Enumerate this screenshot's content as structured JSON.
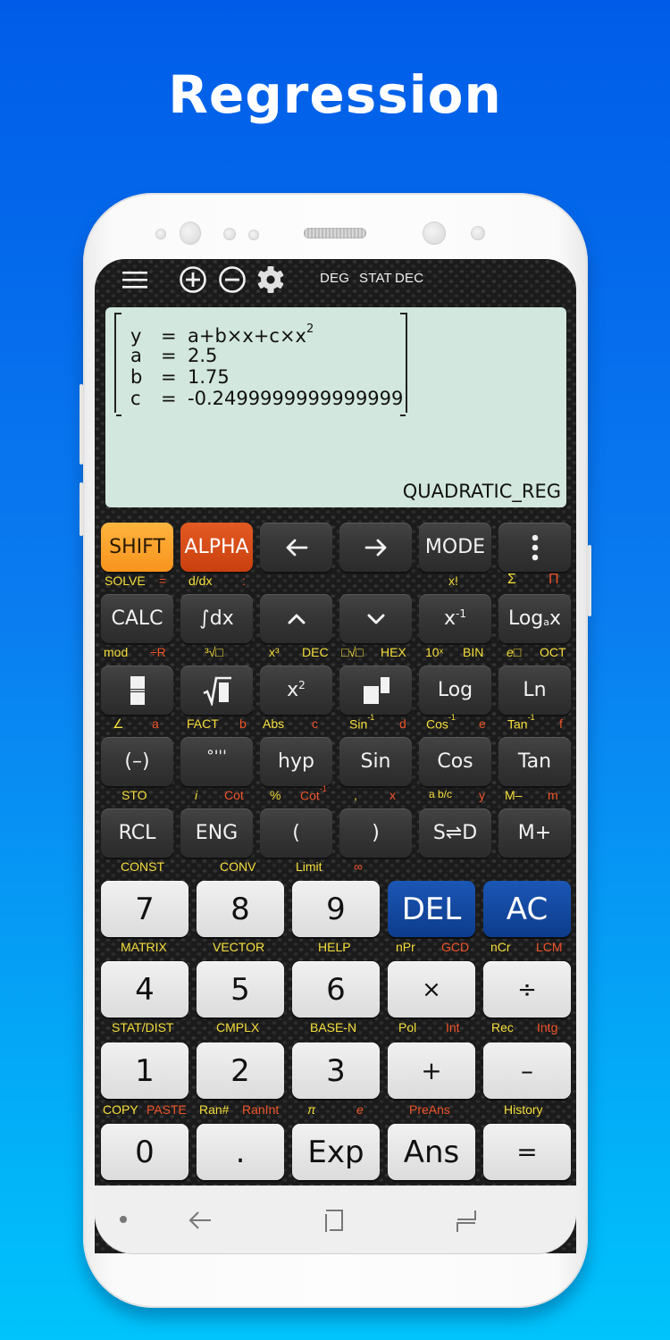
{
  "headline": "Regression",
  "colors": {
    "background_top": "#005ce8",
    "background_bottom": "#00c4fb",
    "shift_key": "#f7941d",
    "alpha_key": "#c9400f",
    "del_ac_key": "#1b56b5",
    "display_bg": "#d2e7dd",
    "secondary_yellow": "#f6df3b",
    "secondary_red": "#f0542a"
  },
  "topbar": {
    "icons": [
      "menu-icon",
      "zoom-in-icon",
      "zoom-out-icon",
      "settings-icon"
    ],
    "modes": [
      "DEG",
      "STAT",
      "DEC"
    ]
  },
  "display": {
    "rows": [
      {
        "var": "y",
        "eq": "=",
        "value": "a+b×x+c×x",
        "sup": "2"
      },
      {
        "var": "a",
        "eq": "=",
        "value": "2.5",
        "sup": ""
      },
      {
        "var": "b",
        "eq": "=",
        "value": "1.75",
        "sup": ""
      },
      {
        "var": "c",
        "eq": "=",
        "value": "-0.2499999999999999",
        "sup": ""
      }
    ],
    "mode_label": "QUADRATIC_REG"
  },
  "keys": {
    "row1": [
      "SHIFT",
      "ALPHA",
      "←",
      "→",
      "MODE",
      "⋮"
    ],
    "row1_secondary": [
      "SOLVE",
      "=",
      "d/dx",
      ":",
      "x!",
      "Σ",
      "Π"
    ],
    "row2": [
      "CALC",
      "∫dx",
      "⌃",
      "⌄",
      "x",
      "Log"
    ],
    "row2_sup": {
      "x_inv": "-1",
      "loga_sub": "a",
      "loga_x": "x"
    },
    "row2_secondary": [
      "mod",
      "÷R",
      "³√□",
      "x³",
      "DEC",
      "□√□",
      "HEX",
      "10ˣ",
      "BIN",
      "e□",
      "OCT"
    ],
    "row3": [
      "fraction",
      "sqrt",
      "x",
      "power",
      "Log",
      "Ln"
    ],
    "row3_sup": {
      "x_sq": "2"
    },
    "row3_secondary": [
      "∠",
      "a",
      "FACT",
      "b",
      "Abs",
      "c",
      "Sin",
      "d",
      "Cos",
      "e",
      "Tan",
      "f"
    ],
    "row3_secondary_sup": "-1",
    "row4": [
      "(–)",
      "°'''",
      "hyp",
      "Sin",
      "Cos",
      "Tan"
    ],
    "row4_secondary": [
      "STO",
      "i",
      "Cot",
      "%",
      "Cot",
      ",",
      "x",
      "a b/c",
      "y",
      "M–",
      "m"
    ],
    "row5": [
      "RCL",
      "ENG",
      "(",
      ")",
      "S⇌D",
      "M+"
    ],
    "row5_secondary": [
      "CONST",
      "CONV",
      "Limit",
      "∞"
    ],
    "row6": [
      "7",
      "8",
      "9",
      "DEL",
      "AC"
    ],
    "row6_secondary": [
      "MATRIX",
      "VECTOR",
      "HELP",
      "nPr",
      "GCD",
      "nCr",
      "LCM"
    ],
    "row7": [
      "4",
      "5",
      "6",
      "×",
      "÷"
    ],
    "row7_secondary": [
      "STAT/DIST",
      "CMPLX",
      "BASE-N",
      "Pol",
      "Int",
      "Rec",
      "Intg"
    ],
    "row8": [
      "1",
      "2",
      "3",
      "+",
      "–"
    ],
    "row8_secondary": [
      "COPY",
      "PASTE",
      "Ran#",
      "RanInt",
      "π",
      "e",
      "PreAns",
      "History"
    ],
    "row9": [
      "0",
      ".",
      "Exp",
      "Ans",
      "="
    ]
  },
  "navbar": [
    "dot-icon",
    "back-icon",
    "home-icon",
    "recents-icon"
  ]
}
